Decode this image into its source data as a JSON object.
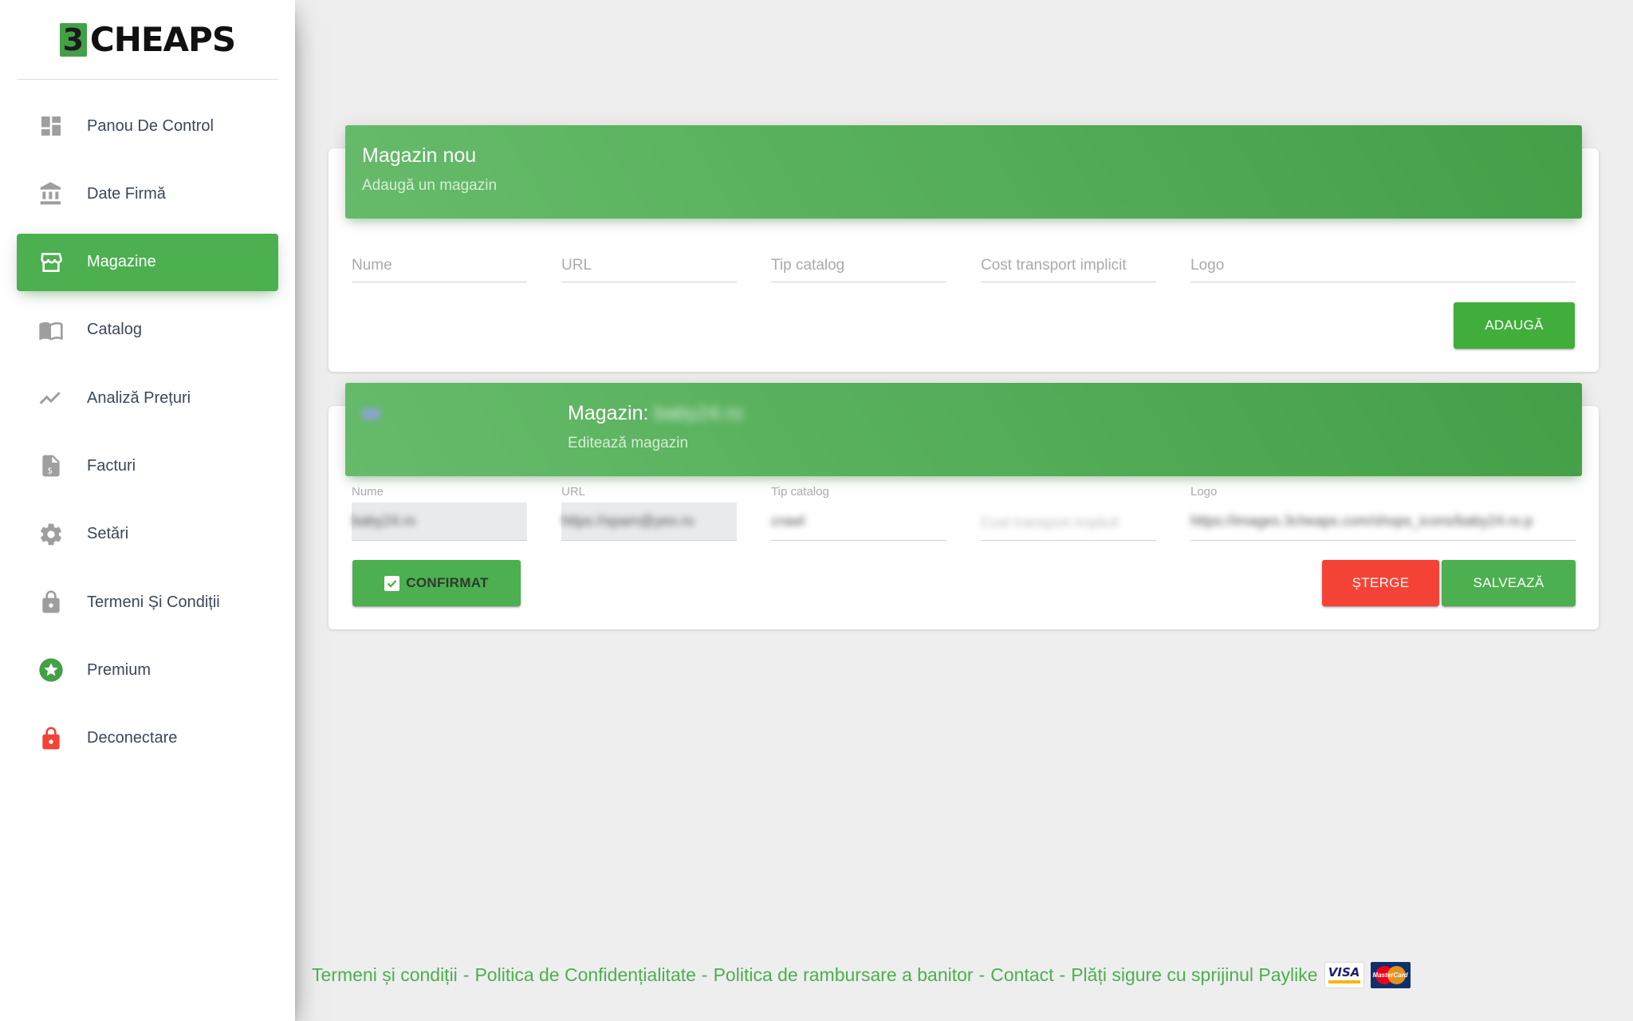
{
  "brand": {
    "logo_digit": "3",
    "logo_text": "CHEAPS"
  },
  "sidebar": {
    "items": [
      {
        "label": "Panou De Control",
        "icon": "dashboard-icon",
        "active": false
      },
      {
        "label": "Date Firmă",
        "icon": "bank-icon",
        "active": false
      },
      {
        "label": "Magazine",
        "icon": "store-icon",
        "active": true
      },
      {
        "label": "Catalog",
        "icon": "book-icon",
        "active": false
      },
      {
        "label": "Analiză Prețuri",
        "icon": "trending-icon",
        "active": false
      },
      {
        "label": "Facturi",
        "icon": "invoice-icon",
        "active": false
      },
      {
        "label": "Setări",
        "icon": "gear-icon",
        "active": false
      },
      {
        "label": "Termeni Și Condiții",
        "icon": "lock-icon",
        "active": false
      },
      {
        "label": "Premium",
        "icon": "star-icon",
        "active": false
      },
      {
        "label": "Deconectare",
        "icon": "logout-lock-icon",
        "active": false
      }
    ]
  },
  "new_store": {
    "title": "Magazin nou",
    "subtitle": "Adaugă un magazin",
    "fields": {
      "name_placeholder": "Nume",
      "url_placeholder": "URL",
      "catalog_placeholder": "Tip catalog",
      "shipping_placeholder": "Cost transport implicit",
      "logo_placeholder": "Logo"
    },
    "add_label": "ADAUGĂ"
  },
  "edit_store": {
    "title_prefix": "Magazin:",
    "store_name": "baby24.ro",
    "subtitle": "Editează magazin",
    "fields": {
      "name_label": "Nume",
      "name_value": "baby24.ro",
      "url_label": "URL",
      "url_value": "https://spam@yeo.ro",
      "catalog_label": "Tip catalog",
      "catalog_value": "crawl",
      "shipping_placeholder": "Cost transport implicit",
      "logo_label": "Logo",
      "logo_value": "https://images.3cheaps.com/shops_icons/baby24.ro.p"
    },
    "confirm_label": "CONFIRMAT",
    "delete_label": "ȘTERGE",
    "save_label": "SALVEAZĂ"
  },
  "footer": {
    "terms": "Termeni și condiții",
    "privacy": "Politica de Confidențialitate",
    "refund": "Politica de rambursare a banitor",
    "contact": "Contact",
    "payments": "Plăți sigure cu sprijinul Paylike",
    "separator": "-",
    "visa": "VISA",
    "mastercard": "MasterCard"
  },
  "colors": {
    "accent": "#4caf50",
    "danger": "#f44336",
    "sidebar_bg": "#ffffff",
    "page_bg": "#eeeeee"
  }
}
